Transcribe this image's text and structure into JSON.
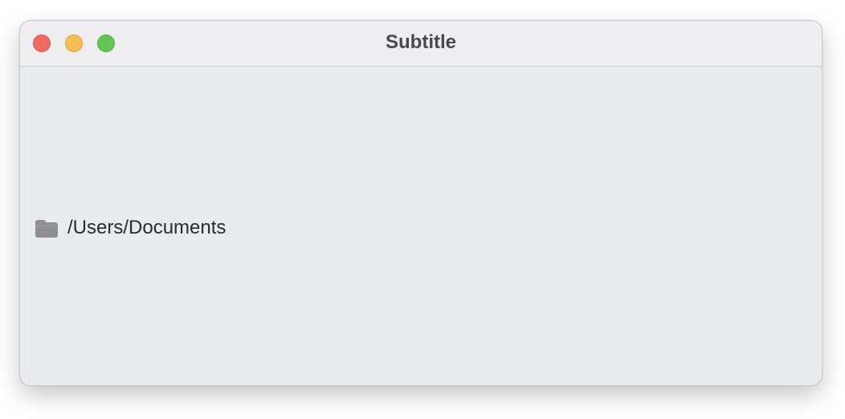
{
  "window": {
    "title": "Subtitle",
    "controls": {
      "close": "close-button",
      "minimize": "minimize-button",
      "zoom": "zoom-button"
    }
  },
  "content": {
    "path_icon": "folder-icon",
    "path": "/Users/Documents"
  },
  "colors": {
    "close": "#ee6a5f",
    "minimize": "#f5be4f",
    "zoom": "#62c554",
    "window_bg": "#e9eaec",
    "folder": "#8e8e93"
  }
}
